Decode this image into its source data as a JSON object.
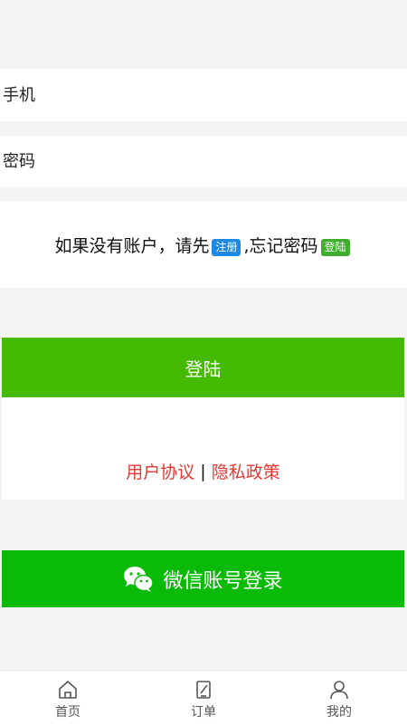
{
  "form": {
    "phone_placeholder": "手机",
    "password_placeholder": "密码"
  },
  "hint": {
    "prefix": "如果没有账户，请先",
    "register_label": "注册",
    "middle": ",忘记密码",
    "login_label": "登陆"
  },
  "login_button": "登陆",
  "agreement": {
    "user_agreement": "用户协议",
    "separator": "|",
    "privacy_policy": "隐私政策"
  },
  "wechat_button": "微信账号登录",
  "tabbar": {
    "items": [
      {
        "label": "首页",
        "icon": "home-icon"
      },
      {
        "label": "订单",
        "icon": "order-icon"
      },
      {
        "label": "我的",
        "icon": "user-icon"
      }
    ]
  },
  "colors": {
    "login_green": "#45ba03",
    "wechat_green": "#09bb07",
    "register_blue": "#1e88e5",
    "link_red": "#e53935"
  }
}
